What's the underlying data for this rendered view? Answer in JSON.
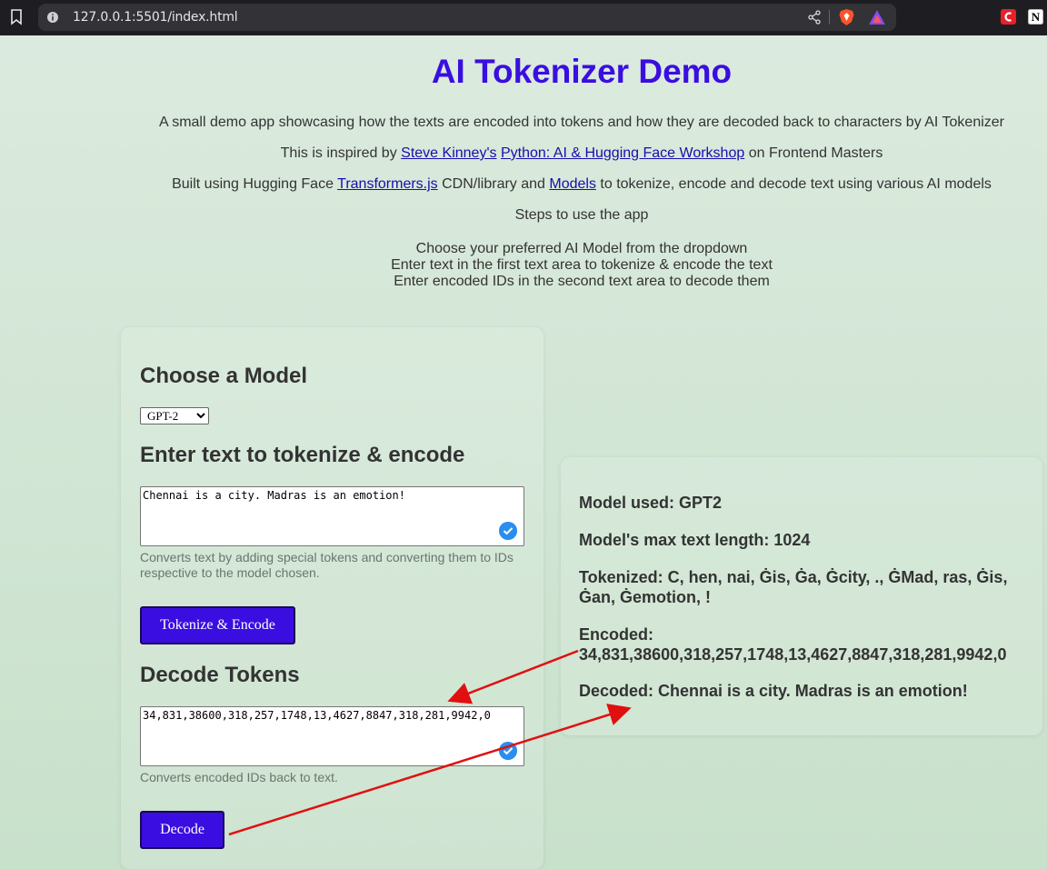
{
  "browser": {
    "url": "127.0.0.1:5501/index.html"
  },
  "header": {
    "title": "AI Tokenizer Demo",
    "description": "A small demo app showcasing how the texts are encoded into tokens and how they are decoded back to characters by AI Tokenizer",
    "inspired_prefix": "This is inspired by ",
    "inspired_link1": "Steve Kinney's",
    "inspired_link2": "Python: AI & Hugging Face Workshop",
    "inspired_suffix": " on Frontend Masters",
    "built_prefix": "Built using Hugging Face ",
    "built_link1": "Transformers.js",
    "built_middle": " CDN/library and ",
    "built_link2": "Models",
    "built_suffix": " to tokenize, encode and decode text using various AI models",
    "steps_title": "Steps to use the app",
    "steps": [
      "Choose your preferred AI Model from the dropdown",
      "Enter text in the first text area to tokenize & encode the text",
      "Enter encoded IDs in the second text area to decode them"
    ]
  },
  "form": {
    "choose_heading": "Choose a Model",
    "model_selected": "GPT-2",
    "encode_heading": "Enter text to tokenize & encode",
    "encode_text": "Chennai is a city. Madras is an emotion!",
    "encode_help": "Converts text by adding special tokens and converting them to IDs respective to the model chosen.",
    "encode_button": "Tokenize & Encode",
    "decode_heading": "Decode Tokens",
    "decode_text": "34,831,38600,318,257,1748,13,4627,8847,318,281,9942,0",
    "decode_help": "Converts encoded IDs back to text.",
    "decode_button": "Decode"
  },
  "results": {
    "model_used": "Model used: GPT2",
    "max_length": "Model's max text length: 1024",
    "tokenized": "Tokenized: C, hen, nai, Ġis, Ġa, Ġcity, ., ĠMad, ras, Ġis, Ġan, Ġemotion, !",
    "encoded_label": "Encoded:",
    "encoded_value": "34,831,38600,318,257,1748,13,4627,8847,318,281,9942,0",
    "decoded": "Decoded: Chennai is a city. Madras is an emotion!"
  },
  "colors": {
    "accent": "#3a0ee0",
    "arrow": "#e01010",
    "check": "#2a8ef0"
  }
}
